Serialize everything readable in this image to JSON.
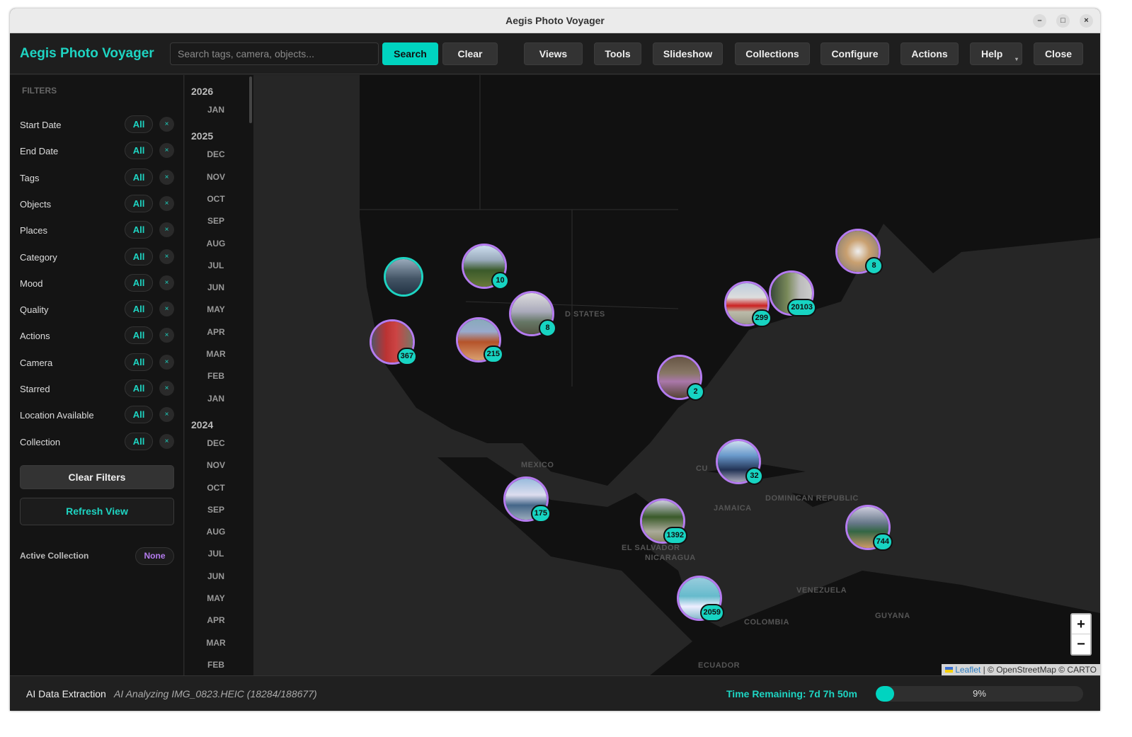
{
  "window": {
    "title": "Aegis Photo Voyager",
    "controls": [
      "–",
      "□",
      "×"
    ]
  },
  "header": {
    "brand": "Aegis Photo Voyager",
    "search_placeholder": "Search tags, camera, objects...",
    "search_value": "",
    "search_label": "Search",
    "clear_label": "Clear",
    "menus": [
      "Views",
      "Tools",
      "Slideshow",
      "Collections",
      "Configure",
      "Actions",
      "Help",
      "Close"
    ]
  },
  "sidebar": {
    "heading": "FILTERS",
    "filters": [
      {
        "label": "Start Date",
        "value": "All"
      },
      {
        "label": "End Date",
        "value": "All"
      },
      {
        "label": "Tags",
        "value": "All"
      },
      {
        "label": "Objects",
        "value": "All"
      },
      {
        "label": "Places",
        "value": "All"
      },
      {
        "label": "Category",
        "value": "All"
      },
      {
        "label": "Mood",
        "value": "All"
      },
      {
        "label": "Quality",
        "value": "All"
      },
      {
        "label": "Actions",
        "value": "All"
      },
      {
        "label": "Camera",
        "value": "All"
      },
      {
        "label": "Starred",
        "value": "All"
      },
      {
        "label": "Location Available",
        "value": "All"
      },
      {
        "label": "Collection",
        "value": "All"
      }
    ],
    "clear_x": "×",
    "clear_filters": "Clear Filters",
    "refresh_view": "Refresh View",
    "active_collection_label": "Active Collection",
    "active_collection_value": "None"
  },
  "timeline": [
    {
      "year": "2026",
      "months": [
        "JAN"
      ]
    },
    {
      "year": "2025",
      "months": [
        "DEC",
        "NOV",
        "OCT",
        "SEP",
        "AUG",
        "JUL",
        "JUN",
        "MAY",
        "APR",
        "MAR",
        "FEB",
        "JAN"
      ]
    },
    {
      "year": "2024",
      "months": [
        "DEC",
        "NOV",
        "OCT",
        "SEP",
        "AUG",
        "JUL",
        "JUN",
        "MAY",
        "APR",
        "MAR",
        "FEB"
      ]
    }
  ],
  "map": {
    "labels": [
      "D STATES",
      "MEXICO",
      "CU",
      "JAMAICA",
      "DOMINICAN REPUBLIC",
      "EL SALVADOR",
      "NICARAGUA",
      "VENEZUELA",
      "GUYANA",
      "COLOMBIA",
      "ECUADOR"
    ],
    "clusters": [
      {
        "count": null,
        "photo": "sea-stack"
      },
      {
        "count": "10",
        "photo": "forest"
      },
      {
        "count": "8",
        "photo": "mountain"
      },
      {
        "count": "367",
        "photo": "red-booth"
      },
      {
        "count": "215",
        "photo": "red-rock"
      },
      {
        "count": "8",
        "photo": "food"
      },
      {
        "count": "299",
        "photo": "rock-hall"
      },
      {
        "count": "20103",
        "photo": "marsh"
      },
      {
        "count": "2",
        "photo": "hiker"
      },
      {
        "count": "32",
        "photo": "airplane-ocean"
      },
      {
        "count": "175",
        "photo": "seascape"
      },
      {
        "count": "1392",
        "photo": "jungle-road"
      },
      {
        "count": "744",
        "photo": "beach"
      },
      {
        "count": "2059",
        "photo": "wave"
      }
    ],
    "zoom_in": "+",
    "zoom_out": "−",
    "attribution": {
      "link": "Leaflet",
      "text": " | © OpenStreetMap © CARTO"
    }
  },
  "status": {
    "task": "AI Data Extraction",
    "detail": "AI Analyzing IMG_0823.HEIC (18284/188677)",
    "time_remaining": "Time Remaining: 7d 7h 50m",
    "progress_percent": 9,
    "progress_label": "9%"
  },
  "colors": {
    "accent": "#00d4c0",
    "marker_ring": "#b57cf0",
    "active_collection": "#b57cf0"
  }
}
